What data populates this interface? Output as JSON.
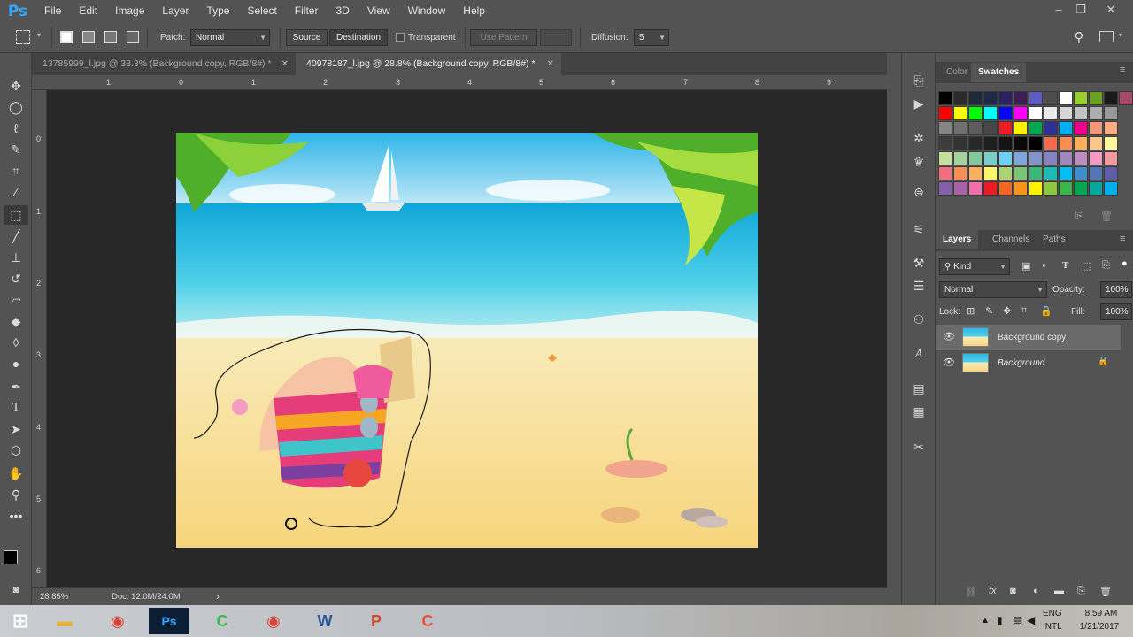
{
  "app": {
    "logo": "Ps",
    "name": "Adobe Photoshop"
  },
  "menu": [
    "File",
    "Edit",
    "Image",
    "Layer",
    "Type",
    "Select",
    "Filter",
    "3D",
    "View",
    "Window",
    "Help"
  ],
  "window_controls": {
    "minimize": "–",
    "restore": "❐",
    "close": "✕"
  },
  "options": {
    "patch_label": "Patch:",
    "patch_mode": "Normal",
    "source_label": "Source",
    "destination_label": "Destination",
    "transparent_label": "Transparent",
    "use_pattern_label": "Use Pattern",
    "diffusion_label": "Diffusion:",
    "diffusion_value": "5"
  },
  "tabs": [
    {
      "label": "13785999_l.jpg @ 33.3% (Background copy, RGB/8#) *",
      "active": false
    },
    {
      "label": "40978187_l.jpg @ 28.8% (Background copy, RGB/8#) *",
      "active": true
    }
  ],
  "ruler": {
    "top": [
      "1",
      "0",
      "1",
      "2",
      "3",
      "4",
      "5",
      "6",
      "7",
      "8",
      "9"
    ],
    "left": [
      "0",
      "1",
      "2",
      "3",
      "4",
      "5",
      "6"
    ]
  },
  "status": {
    "zoom": "28.85%",
    "doc": "Doc: 12.0M/24.0M",
    "arrow": "›"
  },
  "panels": {
    "top_tabs": [
      "Color",
      "Swatches"
    ],
    "active_top": "Swatches",
    "layer_tabs": [
      "Layers",
      "Channels",
      "Paths"
    ],
    "active_layer_tab": "Layers",
    "filter_kind": "Kind",
    "blend_mode": "Normal",
    "opacity_label": "Opacity:",
    "opacity_value": "100%",
    "lock_label": "Lock:",
    "fill_label": "Fill:",
    "fill_value": "100%"
  },
  "layers": [
    {
      "name": "Background copy",
      "selected": true,
      "locked": false
    },
    {
      "name": "Background",
      "selected": false,
      "locked": true
    }
  ],
  "swatch_colors": [
    [
      "#000000",
      "#2b2b2b",
      "#1f2a3a",
      "#1d2a4a",
      "#2b2266",
      "#3d1d55",
      "#5c5cc4",
      "#4d4d4d",
      "#ffffff",
      "#9acd32",
      "#6aa121",
      "#1a1a1a",
      "#a84b6a",
      "#c0201f"
    ],
    [
      "#ff0000",
      "#ffff00",
      "#00ff00",
      "#00ffff",
      "#0000ff",
      "#ff00ff",
      "#ffffff",
      "#ebebeb",
      "#d6d6d6",
      "#c2c2c2",
      "#adadad",
      "#999999"
    ],
    [
      "#858585",
      "#707070",
      "#5c5c5c",
      "#474747",
      "#ed1c24",
      "#fff200",
      "#00a651",
      "#2e3192",
      "#00aeef",
      "#ec008c",
      "#f7977a",
      "#fbad82"
    ],
    [
      "#3d3d3d",
      "#333333",
      "#292929",
      "#1f1f1f",
      "#141414",
      "#0a0a0a",
      "#000000",
      "#f26c4f",
      "#f68e56",
      "#fbaf5d",
      "#fdc68a",
      "#fff79a"
    ],
    [
      "#c4df9b",
      "#a3d39c",
      "#82ca9d",
      "#7bcdc8",
      "#6ecff6",
      "#7ea7d8",
      "#8493ca",
      "#8882be",
      "#a187be",
      "#bc8dbf",
      "#f49ac2",
      "#f6989d"
    ],
    [
      "#f26d7d",
      "#f68e56",
      "#fbaf5d",
      "#fff568",
      "#acd373",
      "#7cc576",
      "#3bb878",
      "#1abbb4",
      "#00bff3",
      "#438ccb",
      "#5574b9",
      "#605ca8"
    ],
    [
      "#855fa8",
      "#a763a8",
      "#f06ea9",
      "#ed1c24",
      "#f26522",
      "#f7941d",
      "#fff200",
      "#8dc63f",
      "#39b54a",
      "#00a651",
      "#00a99d",
      "#00aeef"
    ]
  ],
  "taskbar": {
    "lang": "ENG",
    "layout": "INTL",
    "time": "8:59 AM",
    "date": "1/21/2017"
  }
}
